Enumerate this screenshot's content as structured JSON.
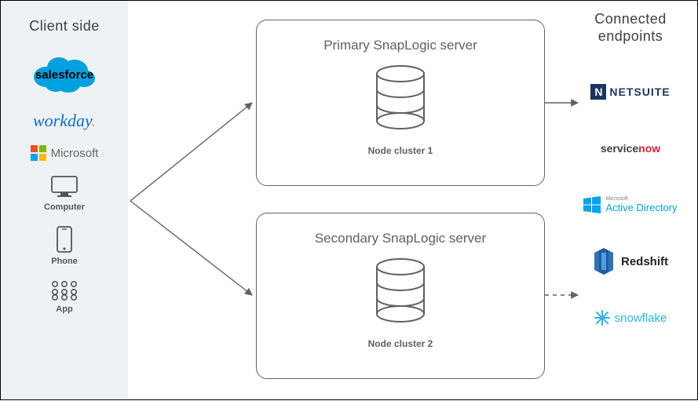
{
  "left": {
    "title": "Client side",
    "items": [
      {
        "name": "salesforce",
        "label": "salesforce"
      },
      {
        "name": "workday",
        "label": "workday"
      },
      {
        "name": "microsoft",
        "label": "Microsoft"
      },
      {
        "name": "computer",
        "label": "Computer"
      },
      {
        "name": "phone",
        "label": "Phone"
      },
      {
        "name": "app",
        "label": "App"
      }
    ]
  },
  "servers": {
    "primary": {
      "title": "Primary SnapLogic server",
      "cluster": "Node cluster 1"
    },
    "secondary": {
      "title": "Secondary SnapLogic server",
      "cluster": "Node cluster 2"
    }
  },
  "right": {
    "title": "Connected endpoints",
    "items": [
      {
        "name": "netsuite",
        "label": "NETSUITE"
      },
      {
        "name": "servicenow",
        "label_a": "service",
        "label_b": "now"
      },
      {
        "name": "active-directory",
        "label_a": "Microsoft",
        "label_b": "Active Directory"
      },
      {
        "name": "redshift",
        "label": "Redshift"
      },
      {
        "name": "snowflake",
        "label": "snowflake"
      }
    ]
  },
  "icons": {
    "salesforce": "salesforce-cloud-icon",
    "workday": "workday-logo-icon",
    "microsoft": "microsoft-squares-icon",
    "computer": "monitor-icon",
    "phone": "smartphone-icon",
    "app": "app-grid-icon",
    "netsuite": "netsuite-n-icon",
    "active-directory": "windows-icon",
    "redshift": "redshift-icon",
    "snowflake": "snowflake-icon",
    "database": "database-cylinder-icon"
  }
}
